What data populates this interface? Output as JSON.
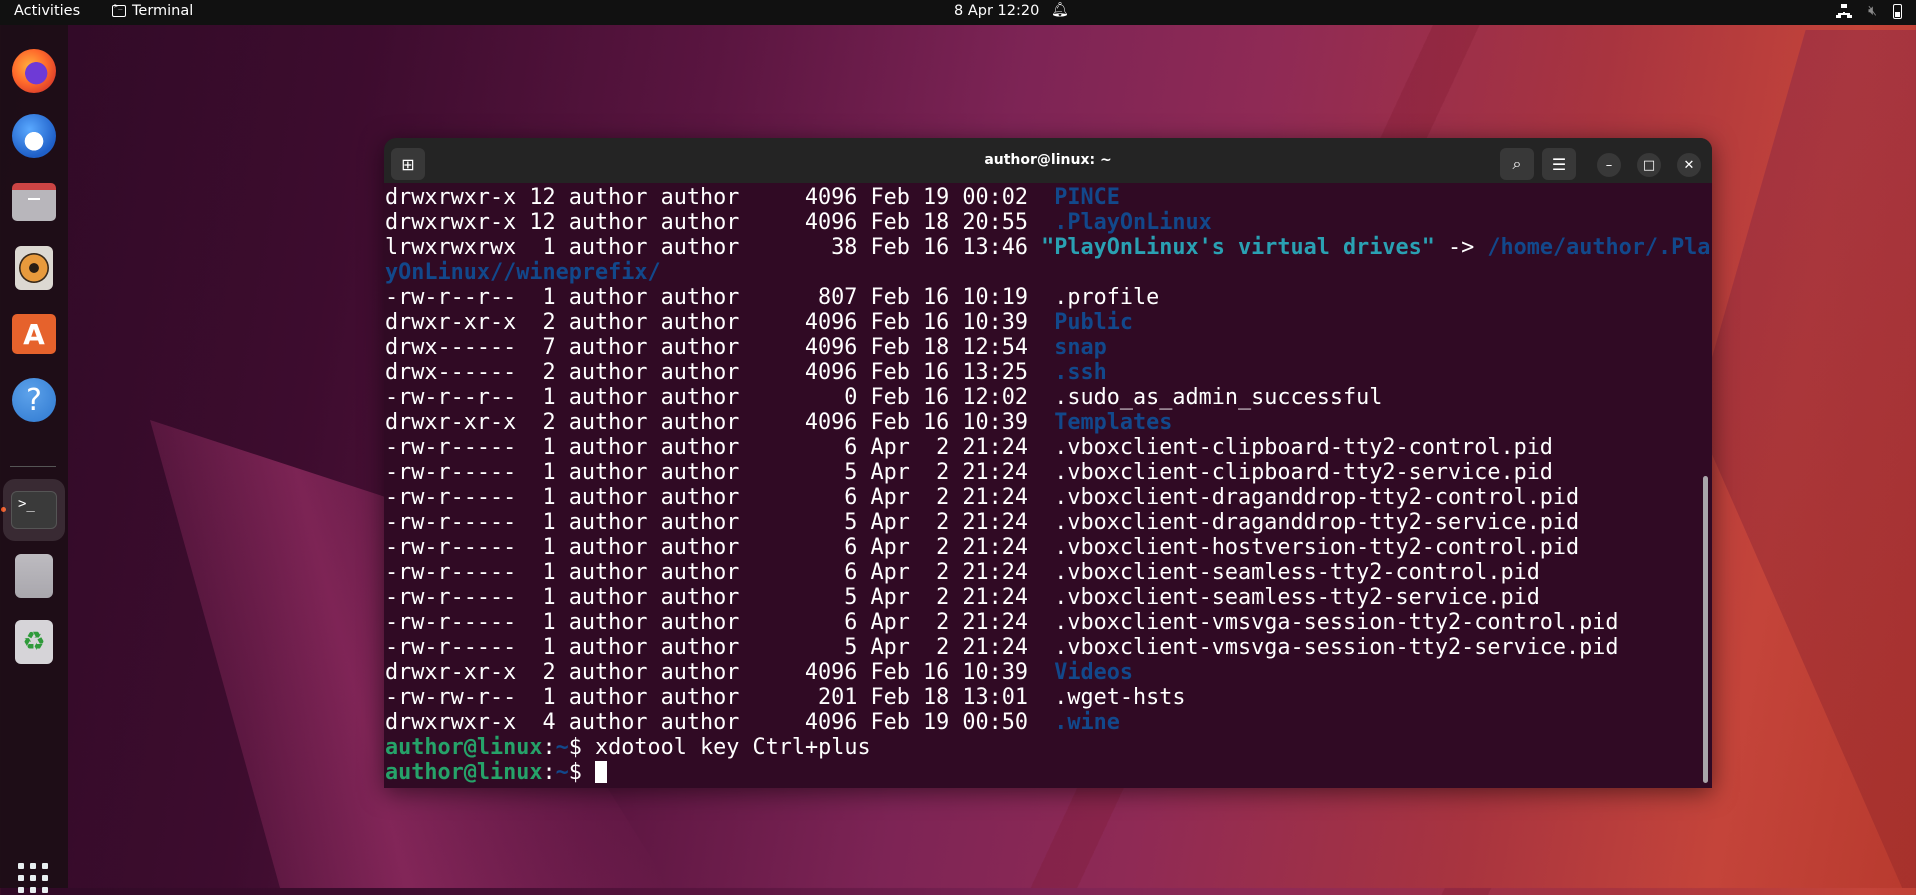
{
  "topbar": {
    "activities": "Activities",
    "app_name": "Terminal",
    "clock": "8 Apr  12:20",
    "icons": [
      "network-icon",
      "volume-muted-icon",
      "battery-icon"
    ]
  },
  "dock": {
    "items": [
      {
        "name": "Firefox",
        "icon": "firefox-icon"
      },
      {
        "name": "Thunderbird",
        "icon": "thunderbird-icon"
      },
      {
        "name": "Files",
        "icon": "files-icon"
      },
      {
        "name": "Rhythmbox",
        "icon": "rhythmbox-icon"
      },
      {
        "name": "App Center",
        "icon": "app-center-icon"
      },
      {
        "name": "Help",
        "icon": "help-icon"
      },
      {
        "name": "Terminal",
        "icon": "terminal-icon",
        "running": true
      },
      {
        "name": "Disks",
        "icon": "disks-icon"
      },
      {
        "name": "Trash",
        "icon": "trash-icon"
      }
    ],
    "show_apps": "show-apps-grid-icon"
  },
  "window": {
    "title": "author@linux: ~",
    "buttons": [
      "new-tab",
      "search",
      "menu",
      "minimize",
      "maximize",
      "close"
    ]
  },
  "terminal": {
    "lines": [
      {
        "meta": "drwxrwxr-x 12 author author     4096 Feb 19 00:02  ",
        "name": "PINCE",
        "type": "dir"
      },
      {
        "meta": "drwxrwxr-x 12 author author     4096 Feb 18 20:55  ",
        "name": ".PlayOnLinux",
        "type": "dir"
      },
      {
        "meta": "lrwxrwxrwx  1 author author       38 Feb 16 13:46 ",
        "name": "\"PlayOnLinux's virtual drives\"",
        "type": "link",
        "arrow": " -> ",
        "target": "/home/author/.Pla"
      },
      {
        "meta": "",
        "name": "yOnLinux//wineprefix/",
        "type": "dir"
      },
      {
        "meta": "-rw-r--r--  1 author author      807 Feb 16 10:19  ",
        "name": ".profile",
        "type": "file"
      },
      {
        "meta": "drwxr-xr-x  2 author author     4096 Feb 16 10:39  ",
        "name": "Public",
        "type": "dir"
      },
      {
        "meta": "drwx------  7 author author     4096 Feb 18 12:54  ",
        "name": "snap",
        "type": "dir"
      },
      {
        "meta": "drwx------  2 author author     4096 Feb 16 13:25  ",
        "name": ".ssh",
        "type": "dir"
      },
      {
        "meta": "-rw-r--r--  1 author author        0 Feb 16 12:02  ",
        "name": ".sudo_as_admin_successful",
        "type": "file"
      },
      {
        "meta": "drwxr-xr-x  2 author author     4096 Feb 16 10:39  ",
        "name": "Templates",
        "type": "dir"
      },
      {
        "meta": "-rw-r-----  1 author author        6 Apr  2 21:24  ",
        "name": ".vboxclient-clipboard-tty2-control.pid",
        "type": "file"
      },
      {
        "meta": "-rw-r-----  1 author author        5 Apr  2 21:24  ",
        "name": ".vboxclient-clipboard-tty2-service.pid",
        "type": "file"
      },
      {
        "meta": "-rw-r-----  1 author author        6 Apr  2 21:24  ",
        "name": ".vboxclient-draganddrop-tty2-control.pid",
        "type": "file"
      },
      {
        "meta": "-rw-r-----  1 author author        5 Apr  2 21:24  ",
        "name": ".vboxclient-draganddrop-tty2-service.pid",
        "type": "file"
      },
      {
        "meta": "-rw-r-----  1 author author        6 Apr  2 21:24  ",
        "name": ".vboxclient-hostversion-tty2-control.pid",
        "type": "file"
      },
      {
        "meta": "-rw-r-----  1 author author        6 Apr  2 21:24  ",
        "name": ".vboxclient-seamless-tty2-control.pid",
        "type": "file"
      },
      {
        "meta": "-rw-r-----  1 author author        5 Apr  2 21:24  ",
        "name": ".vboxclient-seamless-tty2-service.pid",
        "type": "file"
      },
      {
        "meta": "-rw-r-----  1 author author        6 Apr  2 21:24  ",
        "name": ".vboxclient-vmsvga-session-tty2-control.pid",
        "type": "file"
      },
      {
        "meta": "-rw-r-----  1 author author        5 Apr  2 21:24  ",
        "name": ".vboxclient-vmsvga-session-tty2-service.pid",
        "type": "file"
      },
      {
        "meta": "drwxr-xr-x  2 author author     4096 Feb 16 10:39  ",
        "name": "Videos",
        "type": "dir"
      },
      {
        "meta": "-rw-rw-r--  1 author author      201 Feb 18 13:01  ",
        "name": ".wget-hsts",
        "type": "file"
      },
      {
        "meta": "drwxrwxr-x  4 author author     4096 Feb 19 00:50  ",
        "name": ".wine",
        "type": "dir"
      }
    ],
    "prompt_user": "author@linux",
    "prompt_sep": ":",
    "prompt_path": "~",
    "prompt_symbol": "$ ",
    "last_command": "xdotool key Ctrl+plus",
    "current_input": ""
  },
  "colors": {
    "terminal_bg": "#300a24",
    "dir": "#12488b",
    "link": "#2aa1b3",
    "prompt_user": "#26a269",
    "accent": "#e95420"
  }
}
